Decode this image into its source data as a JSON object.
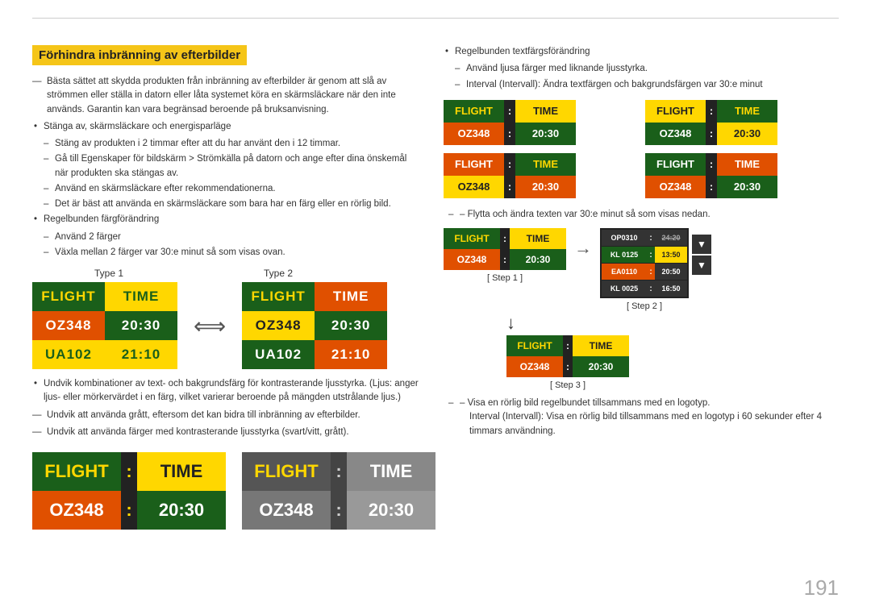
{
  "page": {
    "number": "191",
    "top_line": true
  },
  "section": {
    "title": "Förhindra inbränning av efterbilder",
    "intro": "Bästa sättet att skydda produkten från inbränning av efterbilder är genom att slå av strömmen eller ställa in datorn eller låta systemet köra en skärmsläckare när den inte används. Garantin kan vara begränsad beroende på bruksanvisning.",
    "bullet1": "Stänga av, skärmsläckare och energisparläge",
    "sub1a": "Stäng av produkten i 2 timmar efter att du har använt den i 12 timmar.",
    "sub1b": "Gå till Egenskaper för bildskärm > Strömkälla på datorn och ange efter dina önskemål när produkten ska stängas av.",
    "sub1c": "Använd en skärmsläckare efter rekommendationerna.",
    "sub1d": "Det är bäst att använda en skärmsläckare som bara har en färg eller en rörlig bild.",
    "bullet2": "Regelbunden färgförändring",
    "sub2a": "Använd 2 färger",
    "sub2b": "Växla mellan 2 färger var 30:e minut så som visas ovan.",
    "type1_label": "Type 1",
    "type2_label": "Type 2",
    "flight_word": "FLIGHT",
    "time_word": "TIME",
    "colon": ":",
    "oz348": "OZ348",
    "time_2030": "20:30",
    "ua102": "UA102",
    "time_2110": "21:10",
    "avoid_text": "Undvik kombinationer av text- och bakgrundsfärg för kontrasterande ljusstyrka. (Ljus: anger ljus- eller mörkervärdet i en färg, vilket varierar beroende på mängden utstrålande ljus.)",
    "avoid_grey": "Undvik att använda grått, eftersom det kan bidra till inbränning av efterbilder.",
    "avoid_contrast": "Undvik att använda färger med kontrasterande ljusstyrka (svart/vitt, grått).",
    "right_bullet1": "Regelbunden textfärgsförändring",
    "right_sub1": "Använd ljusa färger med liknande ljusstyrka.",
    "right_sub2": "Interval (Intervall): Ändra textfärgen och bakgrundsfärgen var 30:e minut",
    "right_sub3": "– Flytta och ändra texten var 30:e minut så som visas nedan.",
    "right_sub4": "– Visa en rörlig bild regelbundet tillsammans med en logotyp.",
    "right_sub5": "Interval (Intervall): Visa en rörlig bild tillsammans med en logotyp i 60 sekunder efter 4 timmars användning.",
    "step1_label": "[ Step 1 ]",
    "step2_label": "[ Step 2 ]",
    "step3_label": "[ Step 3 ]",
    "scroll_rows": [
      {
        "code": "OP0310",
        "colon": ":",
        "time": "24:20"
      },
      {
        "code": "KL0125",
        "colon": ":",
        "time": "13:50"
      },
      {
        "code": "EA0110",
        "colon": ":",
        "time": "20:50"
      },
      {
        "code": "KL0025",
        "colon": ":",
        "time": "16:50"
      }
    ]
  }
}
